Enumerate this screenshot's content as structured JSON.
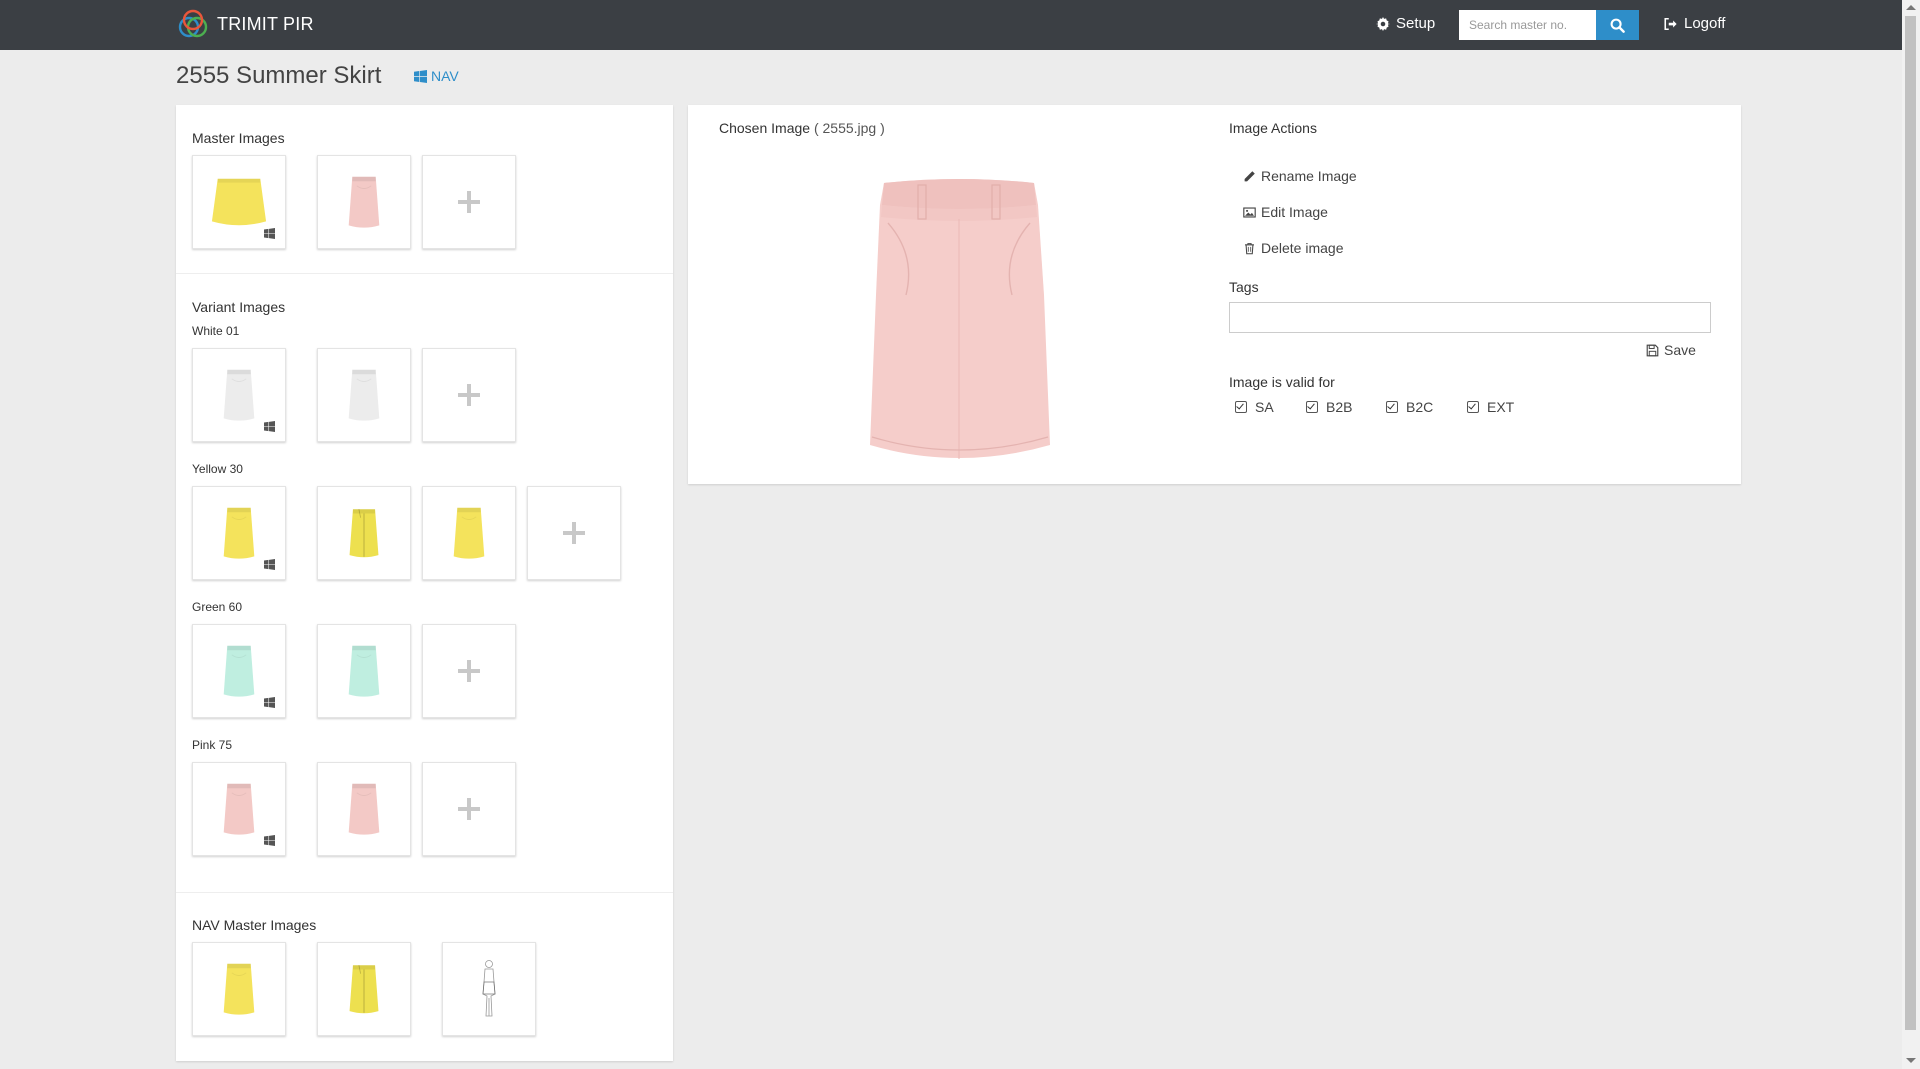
{
  "app": {
    "brand": "TRIMIT PIR"
  },
  "nav": {
    "setup_label": "Setup",
    "search_placeholder": "Search master no.",
    "logoff_label": "Logoff"
  },
  "page": {
    "title": "2555 Summer Skirt",
    "nav_badge": "NAV"
  },
  "master_images": {
    "title": "Master Images"
  },
  "variant_images": {
    "title": "Variant Images",
    "groups": [
      {
        "label": "White 01"
      },
      {
        "label": "Yellow 30"
      },
      {
        "label": "Green 60"
      },
      {
        "label": "Pink 75"
      }
    ]
  },
  "nav_master_images": {
    "title": "NAV Master Images"
  },
  "chosen_image": {
    "label": "Chosen Image",
    "filename": "( 2555.jpg )"
  },
  "image_actions": {
    "title": "Image Actions",
    "rename": "Rename Image",
    "edit": "Edit Image",
    "delete": "Delete image"
  },
  "tags": {
    "label": "Tags",
    "value": ""
  },
  "save_label": "Save",
  "validity": {
    "label": "Image is valid for",
    "options": [
      {
        "label": "SA",
        "checked": true
      },
      {
        "label": "B2B",
        "checked": true
      },
      {
        "label": "B2C",
        "checked": true
      },
      {
        "label": "EXT",
        "checked": true
      }
    ]
  },
  "colors": {
    "navbar": "#3b3f44",
    "accent": "#2e8ec9",
    "yellow": "#f4e35c",
    "pink": "#f3c9c6",
    "white": "#efefef",
    "mint": "#bfeee0"
  }
}
